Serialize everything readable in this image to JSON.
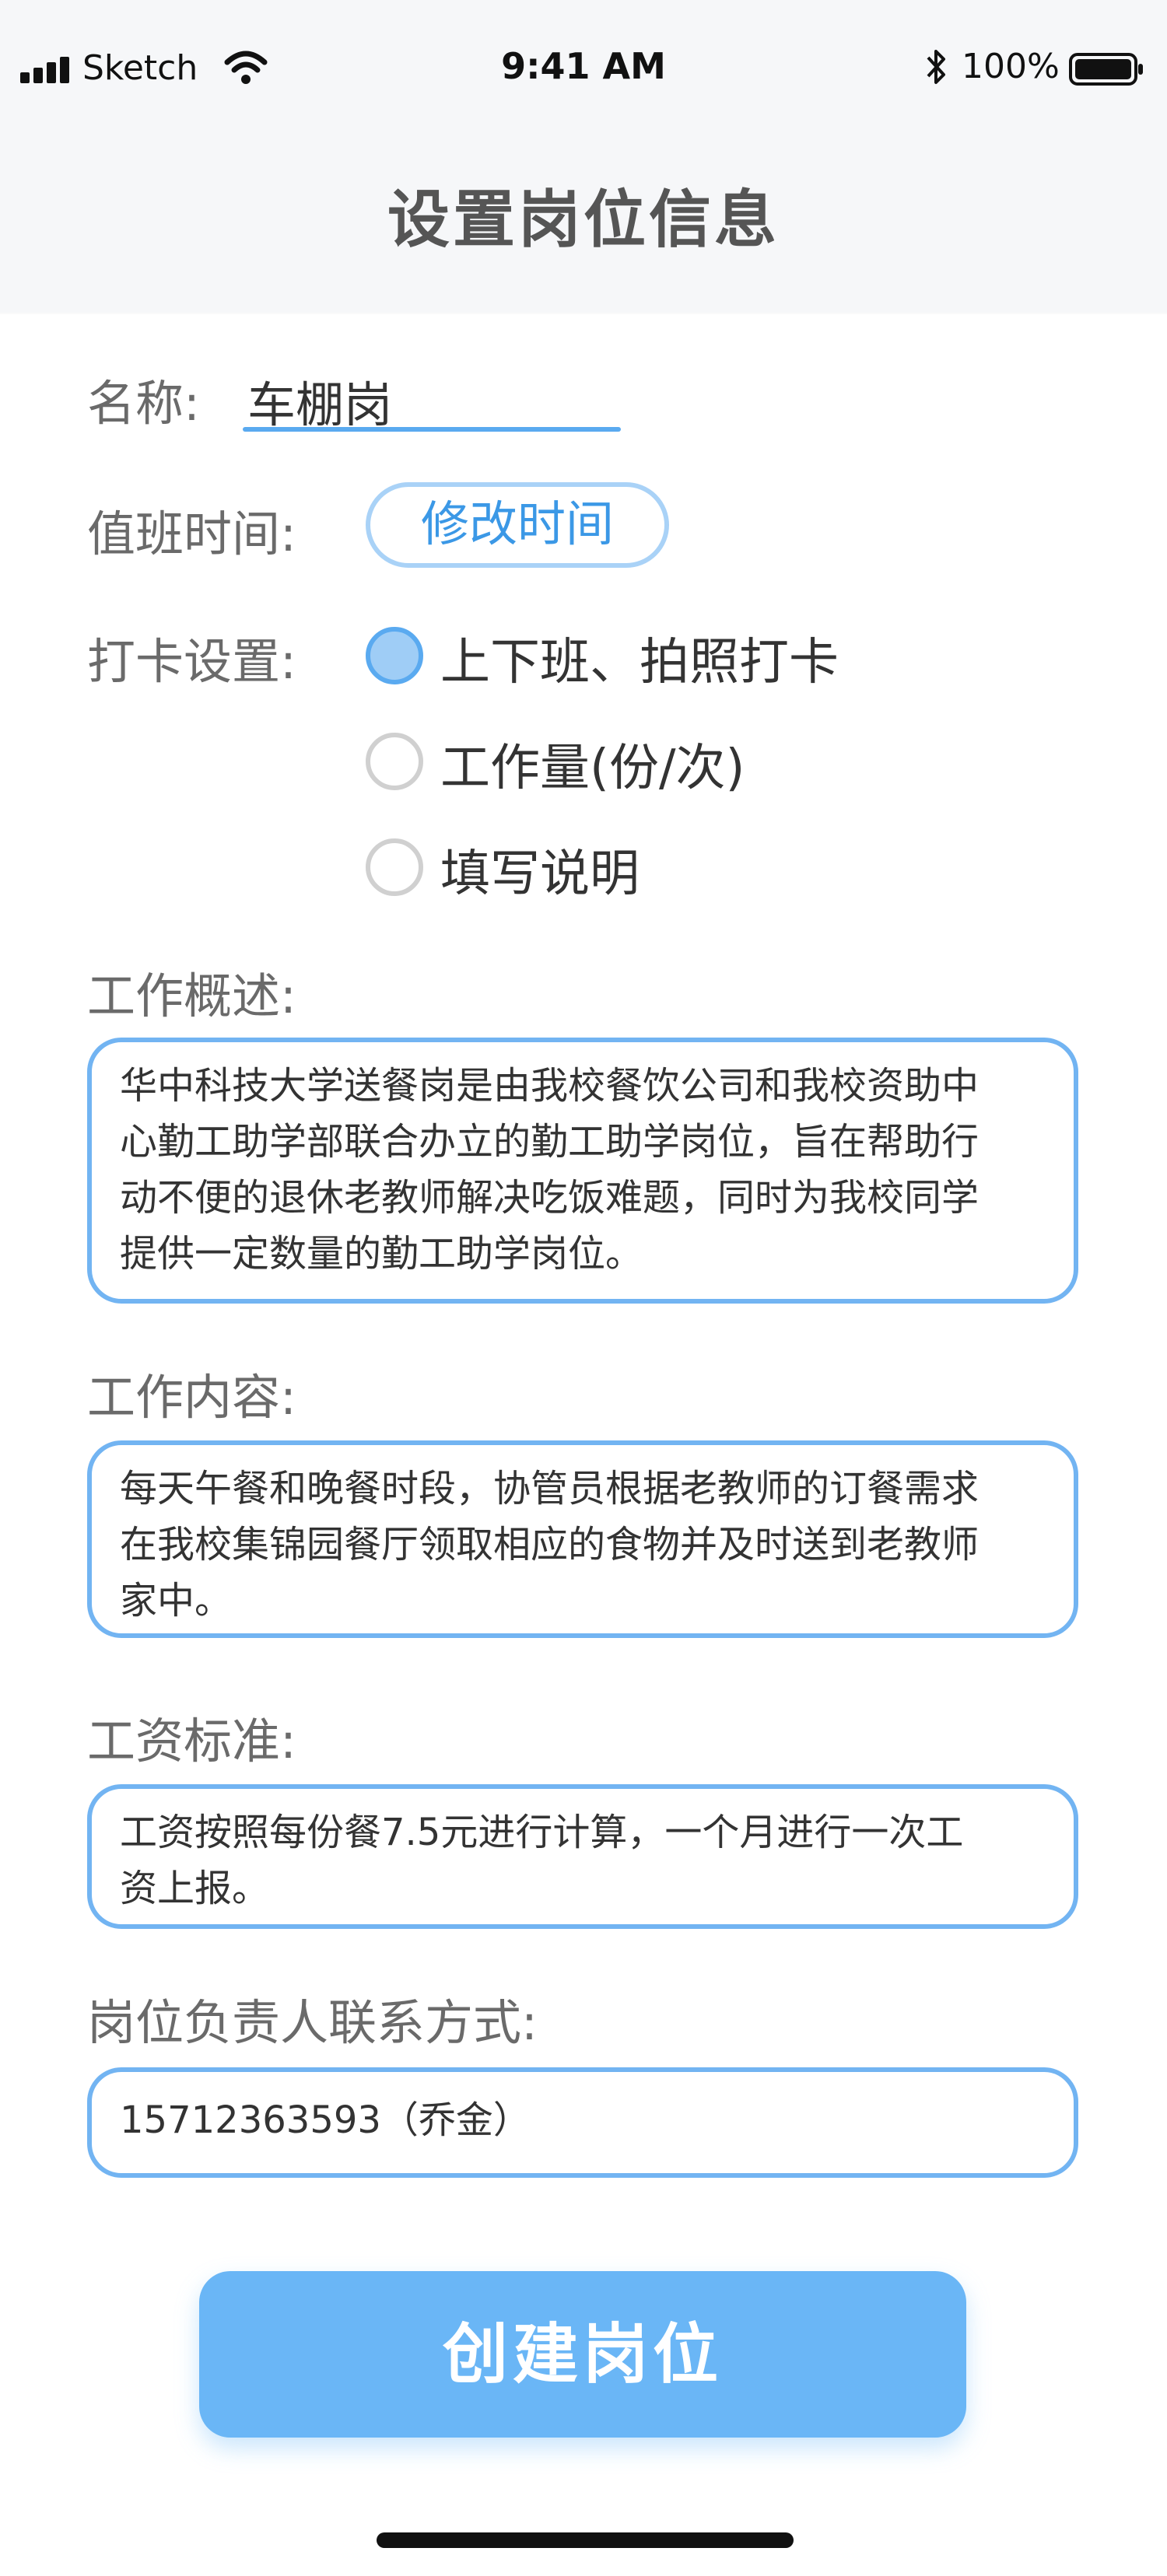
{
  "status_bar": {
    "carrier": "Sketch",
    "time": "9:41 AM",
    "battery": "100%",
    "icons": [
      "signal-icon",
      "wifi-icon",
      "bluetooth-icon",
      "battery-icon"
    ]
  },
  "nav": {
    "title": "设置岗位信息"
  },
  "form": {
    "name_label": "名称:",
    "name_value": "车棚岗",
    "shift_label": "值班时间:",
    "shift_button": "修改时间",
    "checkin_label": "打卡设置:",
    "checkin_options": [
      {
        "label": "上下班、拍照打卡",
        "checked": true
      },
      {
        "label": "工作量(份/次)",
        "checked": false
      },
      {
        "label": "填写说明",
        "checked": false
      }
    ],
    "overview_label": "工作概述:",
    "overview_lines": [
      "华中科技大学送餐岗是由我校餐饮公司和我校资助中",
      "心勤工助学部联合办立的勤工助学岗位，旨在帮助行",
      "动不便的退休老教师解决吃饭难题，同时为我校同学",
      "提供一定数量的勤工助学岗位。"
    ],
    "content_label": "工作内容:",
    "content_lines": [
      "每天午餐和晚餐时段，协管员根据老教师的订餐需求",
      "在我校集锦园餐厅领取相应的食物并及时送到老教师",
      "家中。"
    ],
    "wage_label": "工资标准:",
    "wage_lines": [
      "工资按照每份餐7.5元进行计算，一个月进行一次工",
      "资上报。"
    ],
    "contact_label": "岗位负责人联系方式:",
    "contact_value": "15712363593（乔金）"
  },
  "submit": {
    "label": "创建岗位"
  },
  "colors": {
    "accent": "#5aaaf0",
    "button": "#6ab6f6",
    "label_text": "#6a6a6a"
  }
}
